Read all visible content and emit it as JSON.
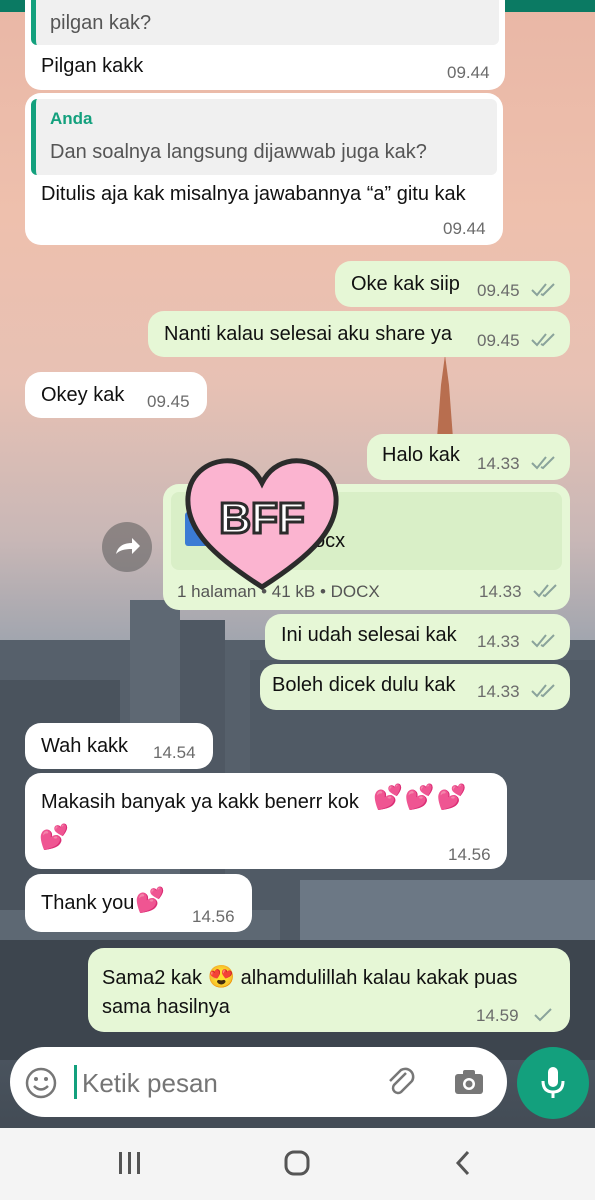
{
  "chat": {
    "quote1_text": "pilgan kak?",
    "msg1": {
      "text": "Pilgan kakk",
      "time": "09.44"
    },
    "msg2": {
      "quote_name": "Anda",
      "quote_text": "Dan soalnya langsung dijawwab juga kak?",
      "text": "Ditulis aja kak misalnya jawabannya “a” gitu kak",
      "time": "09.44"
    },
    "msg3": {
      "text": "Oke kak siip",
      "time": "09.45"
    },
    "msg4": {
      "text": "Nanti kalau selesai aku share ya",
      "time": "09.45"
    },
    "msg5": {
      "text": "Okey kak",
      "time": "09.45"
    },
    "msg6": {
      "text": "Halo kak",
      "time": "14.33"
    },
    "doc": {
      "name_suffix": "ocx",
      "meta": "1 halaman • 41 kB • DOCX",
      "time": "14.33"
    },
    "msg7": {
      "text": "Ini udah selesai kak",
      "time": "14.33"
    },
    "msg8": {
      "text": "Boleh dicek dulu kak",
      "time": "14.33"
    },
    "msg9": {
      "text": "Wah kakk",
      "time": "14.54"
    },
    "msg10": {
      "text": "Makasih banyak ya kakk benerr kok",
      "time": "14.56"
    },
    "msg11": {
      "text": "Thank you",
      "time": "14.56"
    },
    "msg12": {
      "text_a": "Sama2 kak",
      "text_b": "alhamdulillah kalau kakak puas",
      "text_c": "sama hasilnya",
      "time": "14.59"
    }
  },
  "sticker": {
    "label": "BFF"
  },
  "input": {
    "placeholder": "Ketik pesan"
  },
  "icons": [
    "emoji-icon",
    "attach-icon",
    "camera-icon",
    "mic-icon",
    "forward-icon",
    "recent-apps-icon",
    "home-icon",
    "back-icon"
  ],
  "colors": {
    "accent": "#13a07d",
    "outgoing_bubble": "#e6f7d6",
    "incoming_bubble": "#ffffff",
    "tick": "#8aa39b"
  }
}
